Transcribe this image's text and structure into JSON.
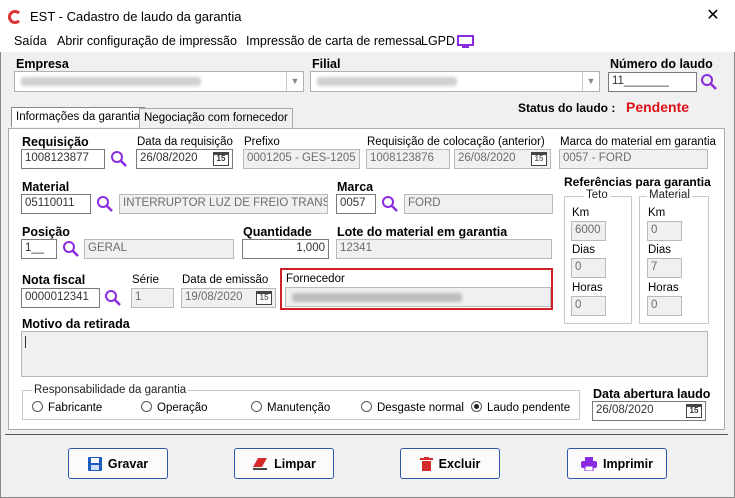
{
  "window": {
    "title": "EST - Cadastro de laudo da garantia",
    "close": "✕"
  },
  "menu": [
    "Saída",
    "Abrir configuração de impressão",
    "Impressão de carta de remessa",
    "LGPD"
  ],
  "header": {
    "empresa_label": "Empresa",
    "filial_label": "Filial",
    "numero_label": "Número do laudo",
    "numero_value": "11_______",
    "status_label": "Status do laudo :",
    "status_value": "Pendente"
  },
  "tabs": [
    "Informações da garantia",
    "Negociação com fornecedor"
  ],
  "form": {
    "requisicao_label": "Requisição",
    "requisicao_value": "1008123877",
    "data_req_label": "Data da requisição",
    "data_req_value": "26/08/2020",
    "prefixo_label": "Prefixo",
    "prefixo_value": "0001205 - GES-1205",
    "req_col_label": "Requisição de colocação (anterior)",
    "req_col_value": "1008123876",
    "req_col_date": "26/08/2020",
    "marca_mat_label": "Marca do material em garantia",
    "marca_mat_value": "0057 - FORD",
    "material_label": "Material",
    "material_code": "05110011",
    "material_desc": "INTERRUPTOR LUZ DE FREIO TRANSIT",
    "marca_label": "Marca",
    "marca_code": "0057",
    "marca_desc": "FORD",
    "posicao_label": "Posição",
    "posicao_code": "1__",
    "posicao_desc": "GERAL",
    "quantidade_label": "Quantidade",
    "quantidade_value": "1,000",
    "lote_label": "Lote do material em garantia",
    "lote_value": "12341",
    "nota_label": "Nota fiscal",
    "nota_value": "0000012341",
    "serie_label": "Série",
    "serie_value": "1",
    "emissao_label": "Data de emissão",
    "emissao_value": "19/08/2020",
    "fornecedor_label": "Fornecedor",
    "motivo_label": "Motivo da retirada"
  },
  "referencias": {
    "title": "Referências para garantia",
    "teto_label": "Teto",
    "material_label": "Material",
    "km_label": "Km",
    "dias_label": "Dias",
    "horas_label": "Horas",
    "teto_km": "6000",
    "teto_dias": "0",
    "teto_horas": "0",
    "mat_km": "0",
    "mat_dias": "7",
    "mat_horas": "0"
  },
  "responsabilidade": {
    "label": "Responsabilidade da garantia",
    "options": [
      "Fabricante",
      "Operação",
      "Manutenção",
      "Desgaste normal",
      "Laudo pendente"
    ],
    "selected": "Laudo pendente"
  },
  "data_abertura": {
    "label": "Data abertura laudo",
    "value": "26/08/2020"
  },
  "calendar_glyph": "15",
  "buttons": {
    "gravar": "Gravar",
    "limpar": "Limpar",
    "excluir": "Excluir",
    "imprimir": "Imprimir"
  },
  "colors": {
    "accent": "#8a2be2",
    "status": "#e0101a",
    "button_border": "#2f57a8",
    "highlight": "#d0202a"
  }
}
